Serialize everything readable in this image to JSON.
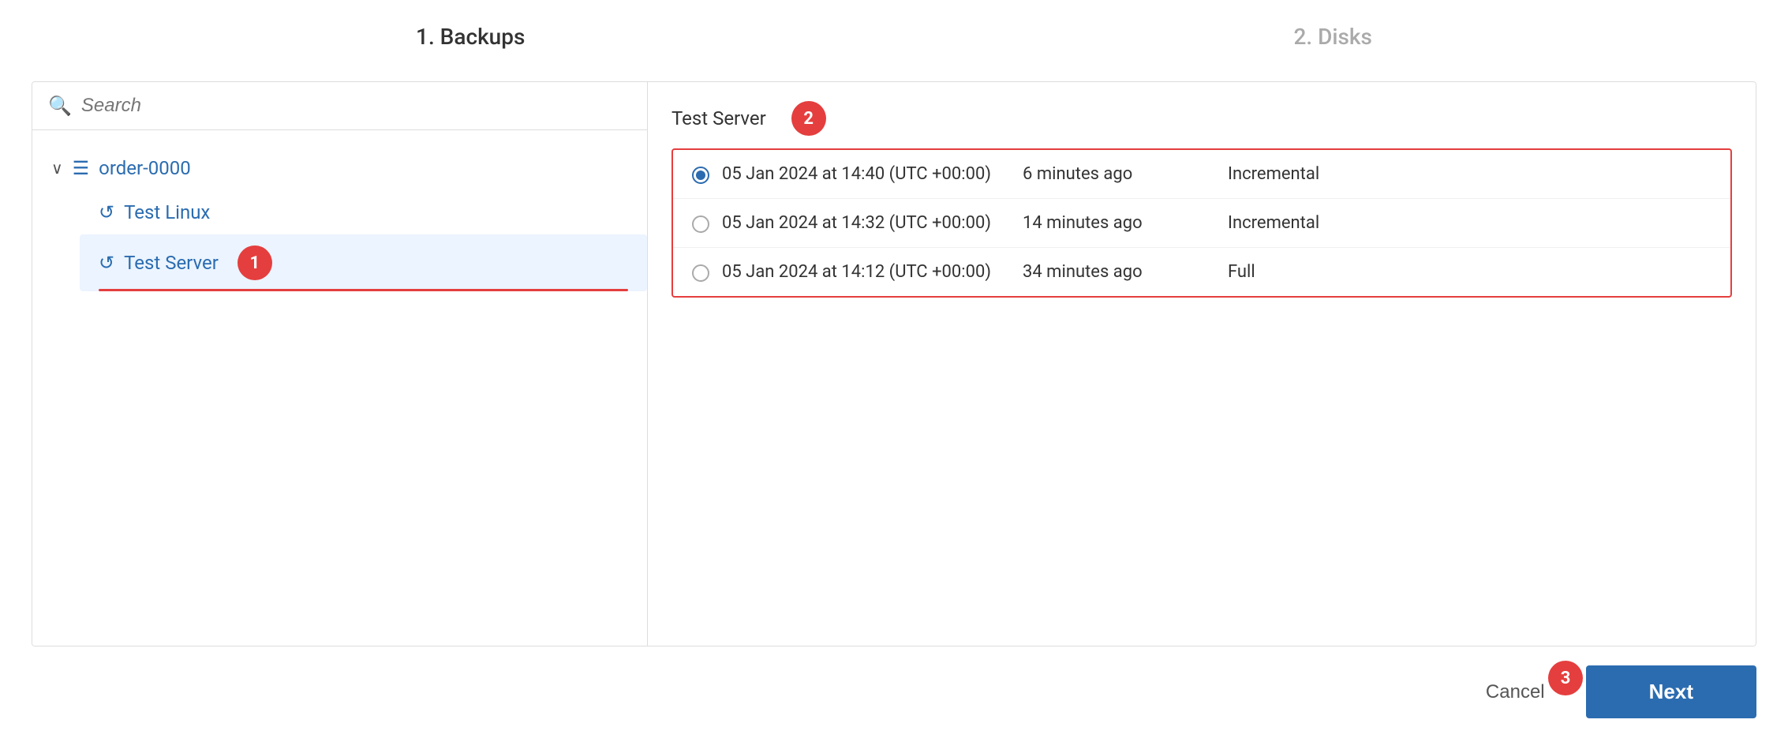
{
  "wizard": {
    "step1_label": "1. Backups",
    "step2_label": "2. Disks"
  },
  "search": {
    "placeholder": "Search"
  },
  "tree": {
    "group_label": "order-0000",
    "items": [
      {
        "label": "Test Linux"
      },
      {
        "label": "Test Server",
        "selected": true
      }
    ]
  },
  "right_panel": {
    "title": "Test Server",
    "backups": [
      {
        "datetime": "05 Jan 2024 at 14:40 (UTC +00:00)",
        "ago": "6 minutes ago",
        "type": "Incremental",
        "selected": true
      },
      {
        "datetime": "05 Jan 2024 at 14:32 (UTC +00:00)",
        "ago": "14 minutes ago",
        "type": "Incremental",
        "selected": false
      },
      {
        "datetime": "05 Jan 2024 at 14:12 (UTC +00:00)",
        "ago": "34 minutes ago",
        "type": "Full",
        "selected": false
      }
    ]
  },
  "footer": {
    "cancel_label": "Cancel",
    "next_label": "Next"
  },
  "badges": {
    "badge1": "1",
    "badge2": "2",
    "badge3": "3"
  }
}
